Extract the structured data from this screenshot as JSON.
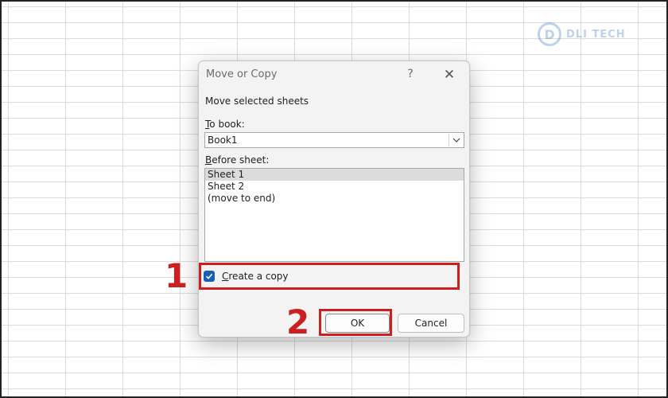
{
  "watermark": {
    "logo_letter": "D",
    "text": "DLI TECH"
  },
  "dialog": {
    "title": "Move or Copy",
    "help_label": "?",
    "close_label": "✕",
    "instruction": "Move selected sheets",
    "to_book": {
      "label_prefix": "T",
      "label_rest": "o book:",
      "value": "Book1"
    },
    "before_sheet": {
      "label_prefix": "B",
      "label_rest": "efore sheet:",
      "items": [
        "Sheet 1",
        "Sheet 2",
        "(move to end)"
      ],
      "selected_index": 0
    },
    "create_copy": {
      "label_prefix": "C",
      "label_rest": "reate a copy",
      "checked": true
    },
    "ok_label": "OK",
    "cancel_label": "Cancel"
  },
  "annotations": {
    "step1": "1",
    "step2": "2"
  },
  "colors": {
    "accent": "#1a5fb4",
    "annotation_red": "#cc1f1f",
    "dialog_bg": "#f3f3f3"
  },
  "icons": {
    "dropdown": "chevron-down-icon",
    "checkmark": "checkmark-icon",
    "close": "close-icon",
    "help": "help-icon"
  }
}
